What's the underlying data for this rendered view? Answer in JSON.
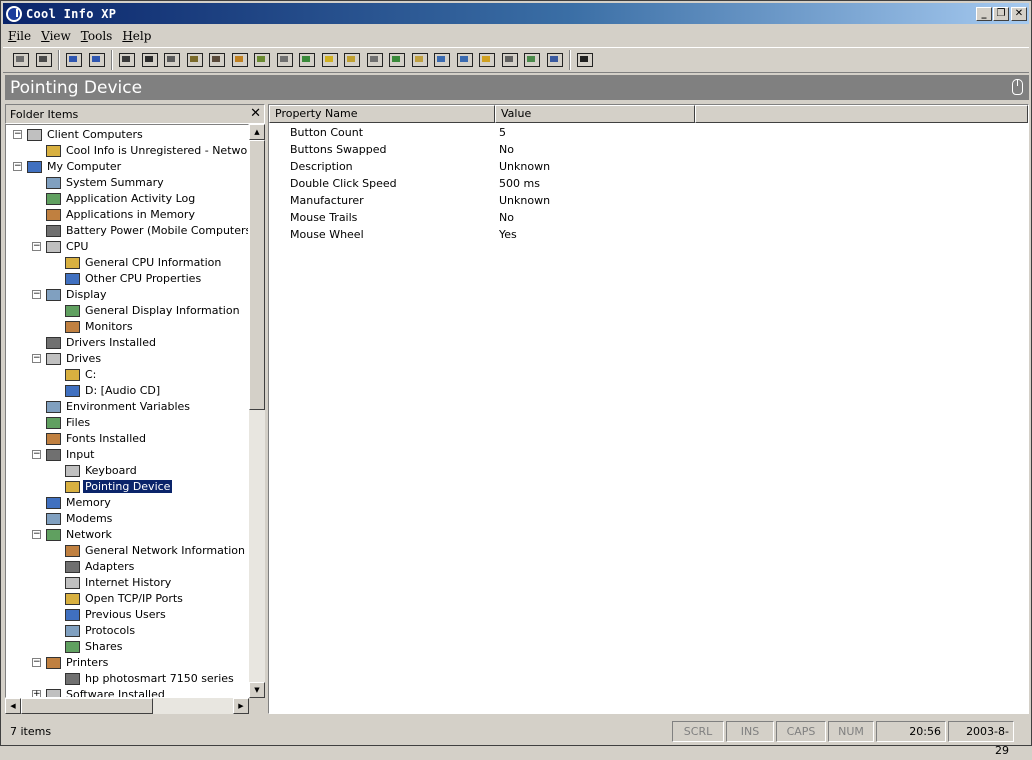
{
  "window": {
    "title": "Cool Info XP"
  },
  "menu": [
    {
      "pre": "",
      "u": "F",
      "rest": "ile"
    },
    {
      "pre": "",
      "u": "V",
      "rest": "iew"
    },
    {
      "pre": "",
      "u": "T",
      "rest": "ools"
    },
    {
      "pre": "",
      "u": "H",
      "rest": "elp"
    }
  ],
  "header": {
    "title": "Pointing Device"
  },
  "left_pane": {
    "title": "Folder Items"
  },
  "tree": [
    {
      "label": "Client Computers",
      "depth": 0,
      "expander": "minus",
      "icon": "network-computers-icon"
    },
    {
      "label": "Cool Info is Unregistered - Network V",
      "depth": 1,
      "expander": "",
      "icon": "computer-icon"
    },
    {
      "label": "My Computer",
      "depth": 0,
      "expander": "minus",
      "icon": "my-computer-icon"
    },
    {
      "label": "System Summary",
      "depth": 1,
      "expander": "",
      "icon": "computer-icon"
    },
    {
      "label": "Application Activity Log",
      "depth": 1,
      "expander": "",
      "icon": "log-icon"
    },
    {
      "label": "Applications in Memory",
      "depth": 1,
      "expander": "",
      "icon": "applications-icon"
    },
    {
      "label": "Battery Power (Mobile Computers)",
      "depth": 1,
      "expander": "",
      "icon": "battery-icon"
    },
    {
      "label": "CPU",
      "depth": 1,
      "expander": "minus",
      "icon": "cpu-icon"
    },
    {
      "label": "General CPU Information",
      "depth": 2,
      "expander": "",
      "icon": "cpu-info-icon"
    },
    {
      "label": "Other CPU Properties",
      "depth": 2,
      "expander": "",
      "icon": "cpu-properties-icon"
    },
    {
      "label": "Display",
      "depth": 1,
      "expander": "minus",
      "icon": "display-icon"
    },
    {
      "label": "General Display Information",
      "depth": 2,
      "expander": "",
      "icon": "display-info-icon"
    },
    {
      "label": "Monitors",
      "depth": 2,
      "expander": "",
      "icon": "monitor-icon"
    },
    {
      "label": "Drivers Installed",
      "depth": 1,
      "expander": "",
      "icon": "drivers-icon"
    },
    {
      "label": "Drives",
      "depth": 1,
      "expander": "minus",
      "icon": "drives-icon"
    },
    {
      "label": "C:",
      "depth": 2,
      "expander": "",
      "icon": "hard-drive-icon"
    },
    {
      "label": "D: [Audio CD]",
      "depth": 2,
      "expander": "",
      "icon": "cd-drive-icon"
    },
    {
      "label": "Environment Variables",
      "depth": 1,
      "expander": "",
      "icon": "environment-icon"
    },
    {
      "label": "Files",
      "depth": 1,
      "expander": "",
      "icon": "files-icon"
    },
    {
      "label": "Fonts Installed",
      "depth": 1,
      "expander": "",
      "icon": "fonts-icon"
    },
    {
      "label": "Input",
      "depth": 1,
      "expander": "minus",
      "icon": "input-icon"
    },
    {
      "label": "Keyboard",
      "depth": 2,
      "expander": "",
      "icon": "keyboard-icon"
    },
    {
      "label": "Pointing Device",
      "depth": 2,
      "expander": "",
      "icon": "mouse-icon",
      "selected": true
    },
    {
      "label": "Memory",
      "depth": 1,
      "expander": "",
      "icon": "memory-icon"
    },
    {
      "label": "Modems",
      "depth": 1,
      "expander": "",
      "icon": "modem-icon"
    },
    {
      "label": "Network",
      "depth": 1,
      "expander": "minus",
      "icon": "network-icon"
    },
    {
      "label": "General Network Information",
      "depth": 2,
      "expander": "",
      "icon": "network-info-icon"
    },
    {
      "label": "Adapters",
      "depth": 2,
      "expander": "",
      "icon": "adapter-icon"
    },
    {
      "label": "Internet History",
      "depth": 2,
      "expander": "",
      "icon": "internet-history-icon"
    },
    {
      "label": "Open TCP/IP Ports",
      "depth": 2,
      "expander": "",
      "icon": "ports-icon"
    },
    {
      "label": "Previous Users",
      "depth": 2,
      "expander": "",
      "icon": "users-icon"
    },
    {
      "label": "Protocols",
      "depth": 2,
      "expander": "",
      "icon": "protocols-icon"
    },
    {
      "label": "Shares",
      "depth": 2,
      "expander": "",
      "icon": "shares-icon"
    },
    {
      "label": "Printers",
      "depth": 1,
      "expander": "minus",
      "icon": "printers-icon"
    },
    {
      "label": "hp photosmart 7150 series",
      "depth": 2,
      "expander": "",
      "icon": "printer-icon"
    },
    {
      "label": "Software Installed",
      "depth": 1,
      "expander": "plus",
      "icon": "software-icon"
    }
  ],
  "columns": {
    "name": "Property Name",
    "value": "Value"
  },
  "properties": [
    {
      "name": "Button Count",
      "value": "5"
    },
    {
      "name": "Buttons Swapped",
      "value": "No"
    },
    {
      "name": "Description",
      "value": "Unknown"
    },
    {
      "name": "Double Click Speed",
      "value": "500 ms"
    },
    {
      "name": "Manufacturer",
      "value": "Unknown"
    },
    {
      "name": "Mouse Trails",
      "value": "No"
    },
    {
      "name": "Mouse Wheel",
      "value": "Yes"
    }
  ],
  "status": {
    "items": "7 items",
    "scrl": "SCRL",
    "ins": "INS",
    "caps": "CAPS",
    "num": "NUM",
    "time": "20:56",
    "date": "2003-8-29"
  },
  "toolbar_icons": [
    "printer-icon",
    "find-icon",
    "refresh-icon",
    "network-refresh-icon",
    "system-summary-icon",
    "log-icon",
    "applications-icon",
    "battery-icon",
    "cpu-icon",
    "display-icon",
    "drivers-icon",
    "drives-icon",
    "environment-icon",
    "files-icon",
    "fonts-icon",
    "input-icon",
    "memory-icon",
    "modem-icon",
    "network-icon",
    "internet-icon",
    "adapter-icon",
    "sound-icon",
    "shares-icon",
    "software-icon",
    "help-icon"
  ],
  "colors": {
    "title_start": "#0a246a",
    "title_end": "#a6caf0",
    "selection": "#0a246a",
    "header_band": "#808080"
  }
}
